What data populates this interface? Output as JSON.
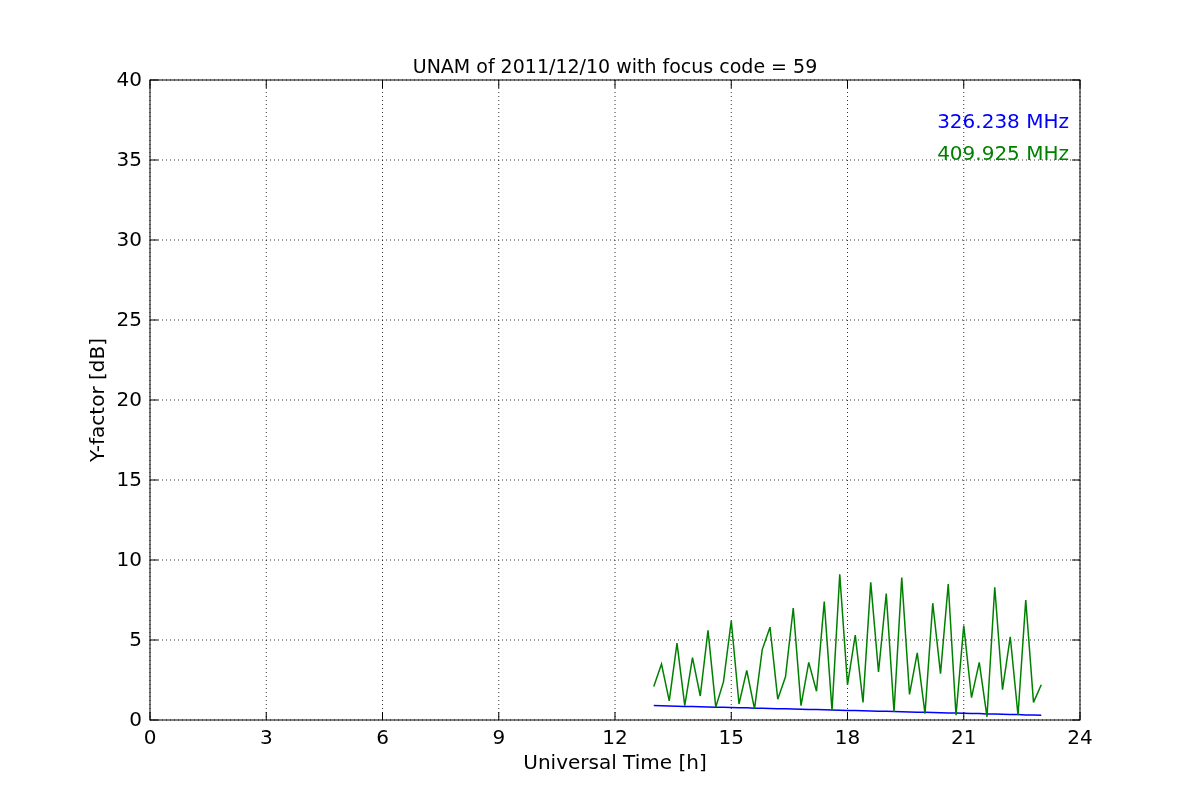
{
  "figure": {
    "chart_data": {
      "type": "line",
      "title": "UNAM of 2011/12/10 with focus code = 59",
      "xlabel": "Universal Time [h]",
      "ylabel": "Y-factor [dB]",
      "x": [
        13,
        13.2,
        13.4,
        13.6,
        13.8,
        14,
        14.2,
        14.4,
        14.6,
        14.8,
        15,
        15.2,
        15.4,
        15.6,
        15.8,
        16,
        16.2,
        16.4,
        16.6,
        16.8,
        17,
        17.2,
        17.4,
        17.6,
        17.8,
        18,
        18.2,
        18.4,
        18.6,
        18.8,
        19,
        19.2,
        19.4,
        19.6,
        19.8,
        20,
        20.2,
        20.4,
        20.6,
        20.8,
        21,
        21.2,
        21.4,
        21.6,
        21.8,
        22,
        22.2,
        22.4,
        22.6,
        22.8,
        23
      ],
      "series": [
        {
          "name": "326.238 MHz",
          "color": "#0000ff",
          "values": [
            0.9,
            0.89,
            0.88,
            0.86,
            0.85,
            0.84,
            0.83,
            0.82,
            0.8,
            0.79,
            0.78,
            0.77,
            0.76,
            0.74,
            0.73,
            0.72,
            0.71,
            0.7,
            0.68,
            0.67,
            0.66,
            0.65,
            0.64,
            0.62,
            0.61,
            0.6,
            0.59,
            0.58,
            0.56,
            0.55,
            0.54,
            0.53,
            0.52,
            0.5,
            0.49,
            0.48,
            0.47,
            0.46,
            0.44,
            0.43,
            0.42,
            0.41,
            0.4,
            0.38,
            0.37,
            0.36,
            0.35,
            0.34,
            0.32,
            0.31,
            0.3
          ]
        },
        {
          "name": "409.925 MHz",
          "color": "#008000",
          "values": [
            2.1,
            3.5,
            1.2,
            4.8,
            0.9,
            3.9,
            1.5,
            5.6,
            0.8,
            2.4,
            6.2,
            1.0,
            3.1,
            0.7,
            4.4,
            5.8,
            1.3,
            2.7,
            7.0,
            0.9,
            3.6,
            1.8,
            7.4,
            0.6,
            9.1,
            2.2,
            5.3,
            1.1,
            8.6,
            3.0,
            7.9,
            0.5,
            8.9,
            1.6,
            4.2,
            0.4,
            7.3,
            2.9,
            8.5,
            0.3,
            5.9,
            1.4,
            3.6,
            0.2,
            8.3,
            1.9,
            5.2,
            0.3,
            7.5,
            1.1,
            2.2
          ]
        }
      ],
      "xlim": [
        0,
        24
      ],
      "ylim": [
        0,
        40
      ],
      "xticks": [
        0,
        3,
        6,
        9,
        12,
        15,
        18,
        21,
        24
      ],
      "yticks": [
        0,
        5,
        10,
        15,
        20,
        25,
        30,
        35,
        40
      ],
      "grid": true
    }
  }
}
